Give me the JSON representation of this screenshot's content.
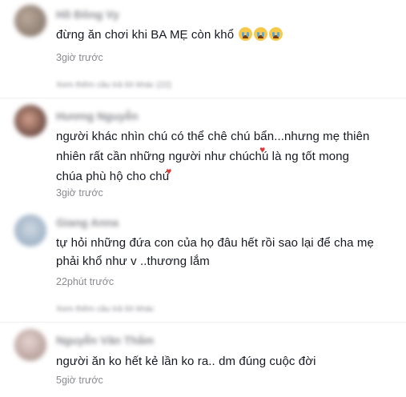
{
  "comments": [
    {
      "username": "Hồ Đông Vy",
      "text": "đừng ăn chơi khi BA MẸ còn khổ",
      "emoji_count": 3,
      "emoji_icon": "loudly-crying-face-icon",
      "time": "3giờ trước",
      "more_replies": "Xem thêm câu trả lời khác (22)"
    },
    {
      "username": "Hương Nguyễn",
      "text_lines": [
        "người khác nhìn chú có thể chê chú bẩn...nhưng mẹ thiên",
        "nhiên rất cần những người như chúchú là ng tốt mong",
        "chúa phù hộ cho chú"
      ],
      "heart_icon": "red-heart-icon",
      "time": "3giờ trước"
    },
    {
      "username": "Giang Anna",
      "text_lines": [
        "tự hỏi những đứa con của họ đâu hết rồi sao lại để cha mẹ",
        "phải khổ như v ..thương lắm"
      ],
      "time": "22phút trước",
      "more_replies": "Xem thêm câu trả lời khác"
    },
    {
      "username": "Nguyễn Văn Thắm",
      "text": "người ăn ko hết kẻ lần ko ra.. dm đúng cuộc đời",
      "time": "5giờ trước"
    }
  ],
  "colors": {
    "text": "#161823",
    "muted": "#8a8b91",
    "heart": "#d93a3a"
  }
}
